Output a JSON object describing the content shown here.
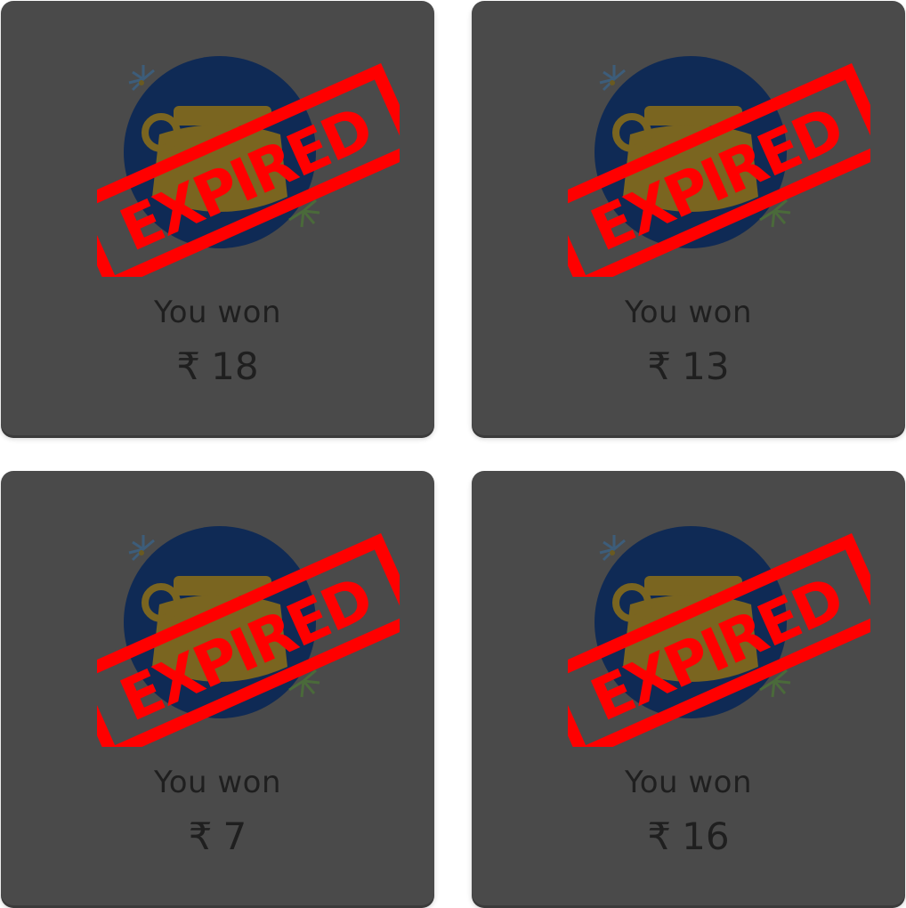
{
  "cards": [
    {
      "label": "You won",
      "currency": "₹",
      "amount": "18",
      "stamp": "EXPIRED"
    },
    {
      "label": "You won",
      "currency": "₹",
      "amount": "13",
      "stamp": "EXPIRED"
    },
    {
      "label": "You won",
      "currency": "₹",
      "amount": "7",
      "stamp": "EXPIRED"
    },
    {
      "label": "You won",
      "currency": "₹",
      "amount": "16",
      "stamp": "EXPIRED"
    }
  ],
  "colors": {
    "card_bg": "#4a4a4a",
    "badge_circle": "#0f2a55",
    "pot_gold": "#7a6520",
    "stamp_red": "#ff0000",
    "text": "#1f1f1f"
  }
}
